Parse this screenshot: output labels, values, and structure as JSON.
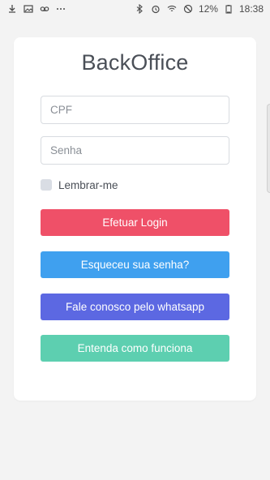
{
  "statusbar": {
    "battery_text": "12%",
    "time": "18:38",
    "left_icons": [
      "download-icon",
      "image-icon",
      "voicemail-icon",
      "more-icon"
    ],
    "right_icons": [
      "bluetooth-icon",
      "alarm-icon",
      "wifi-icon",
      "do-not-disturb-icon",
      "battery-icon"
    ]
  },
  "app": {
    "title": "BackOffice"
  },
  "form": {
    "cpf_placeholder": "CPF",
    "password_placeholder": "Senha",
    "remember_label": "Lembrar-me"
  },
  "buttons": {
    "login": "Efetuar Login",
    "forgot": "Esqueceu sua senha?",
    "whatsapp": "Fale conosco pelo whatsapp",
    "how_it_works": "Entenda como funciona"
  },
  "colors": {
    "login": "#ef5068",
    "forgot": "#3fa0ef",
    "whatsapp": "#5c68e2",
    "how_it_works": "#5dcfb0"
  }
}
